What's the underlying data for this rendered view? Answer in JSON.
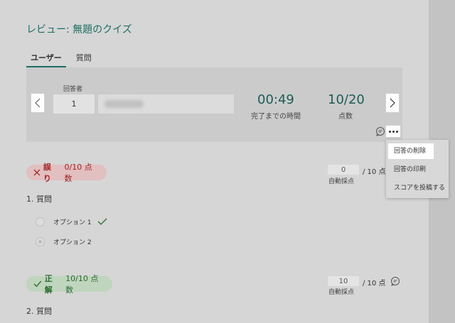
{
  "review": {
    "title": "レビュー: 無題のクイズ",
    "tabs": [
      {
        "label": "ユーザー",
        "active": true
      },
      {
        "label": "質問",
        "active": false
      }
    ]
  },
  "responder": {
    "label": "回答者",
    "number": "1"
  },
  "stats": {
    "time_value": "00:49",
    "time_caption": "完了までの時間",
    "score_value": "10/20",
    "score_caption": "点数"
  },
  "menu": {
    "items": [
      {
        "label": "回答の削除",
        "highlighted": true
      },
      {
        "label": "回答の印刷",
        "highlighted": false
      },
      {
        "label": "スコアを投稿する",
        "highlighted": false
      }
    ]
  },
  "questions": [
    {
      "status": "誤り",
      "status_score": "0/10 点数",
      "points_value": "0",
      "points_total": "/ 10 点",
      "auto_label": "自動採点",
      "title": "1. 質問",
      "options": [
        {
          "label": "オプション 1",
          "correct": true
        },
        {
          "label": "オプション 2",
          "selected": true
        }
      ]
    },
    {
      "status": "正解",
      "status_score": "10/10 点数",
      "points_value": "10",
      "points_total": "/ 10 点",
      "auto_label": "自動採点",
      "title": "2. 質問"
    }
  ],
  "colors": {
    "accent": "#1e6e63",
    "wrong_bg": "#e2bfc0",
    "wrong_text": "#a22626",
    "right_bg": "#bfd5bd",
    "right_text": "#2d6b33"
  }
}
